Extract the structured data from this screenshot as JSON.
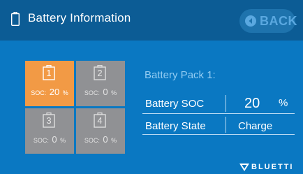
{
  "header": {
    "title": "Battery Information",
    "icon": "battery-icon",
    "back_label": "BACK",
    "back_icon": "arrow-left-circle-icon"
  },
  "batteries": [
    {
      "number": "1",
      "soc_label": "SOC:",
      "soc": "20",
      "unit": "%",
      "selected": true
    },
    {
      "number": "2",
      "soc_label": "SOC:",
      "soc": "0",
      "unit": "%",
      "selected": false
    },
    {
      "number": "3",
      "soc_label": "SOC:",
      "soc": "0",
      "unit": "%",
      "selected": false
    },
    {
      "number": "4",
      "soc_label": "SOC:",
      "soc": "0",
      "unit": "%",
      "selected": false
    }
  ],
  "details": {
    "pack_title": "Battery Pack 1:",
    "soc_label": "Battery SOC",
    "soc_value": "20",
    "soc_unit": "%",
    "state_label": "Battery State",
    "state_value": "Charge"
  },
  "brand": {
    "name": "BLUETTI",
    "icon": "bluetti-logo-icon"
  },
  "colors": {
    "header_bg": "#0c5c95",
    "screen_bg": "#0a78c2",
    "selected_tile": "#f29a45",
    "unselected_tile": "#909194",
    "back_text": "#5aa8e0",
    "pack_title": "#93ccf2"
  }
}
